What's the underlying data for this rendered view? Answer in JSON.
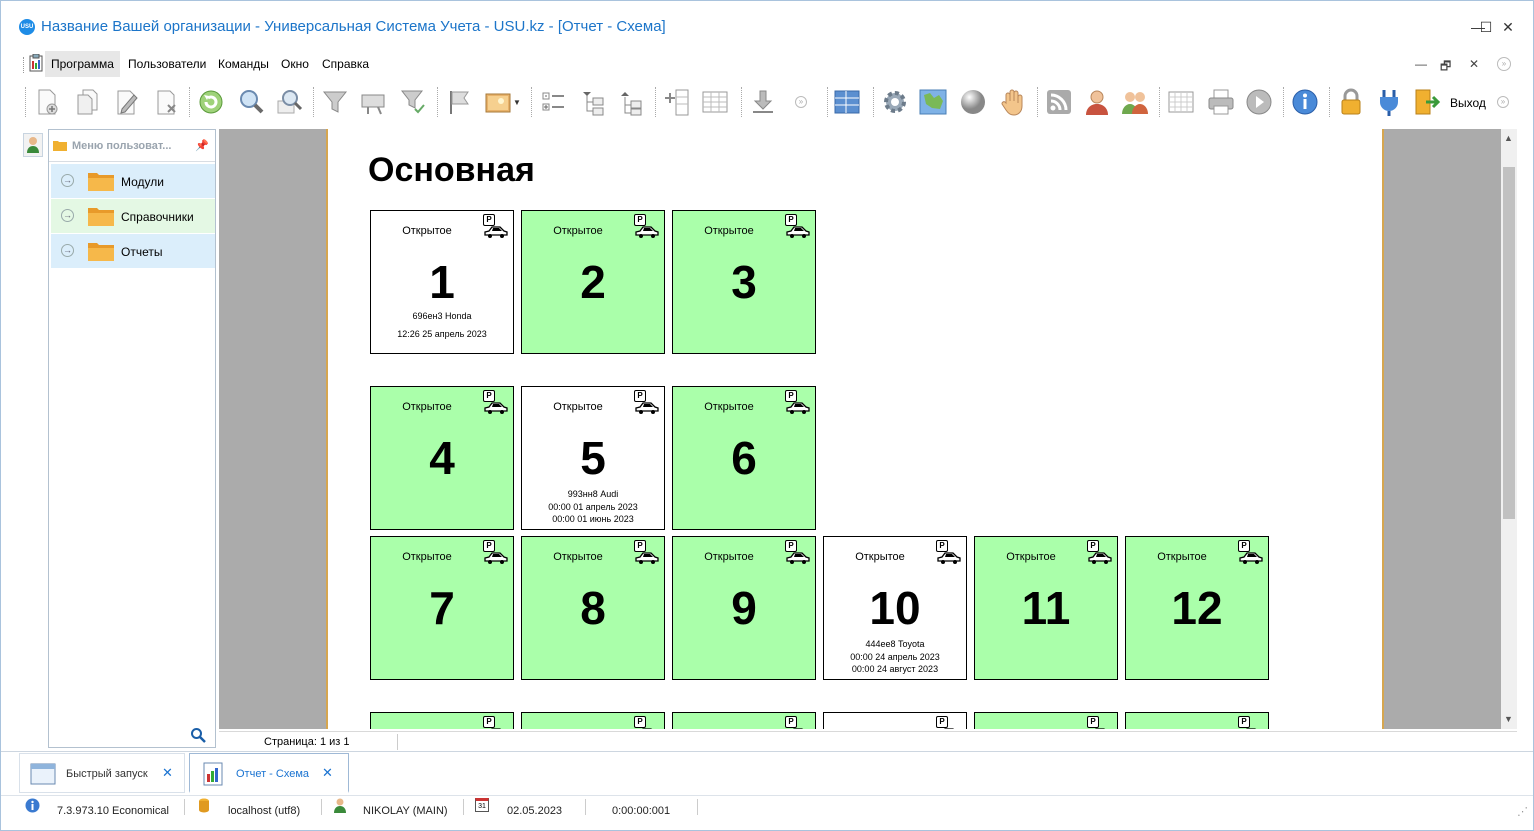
{
  "window": {
    "title": "Название Вашей организации - Универсальная Система Учета - USU.kz - [Отчет - Схема]",
    "logo_text": "USU",
    "controls": {
      "minimize": "—",
      "maximize": "☐",
      "close": "✕"
    }
  },
  "menu": {
    "items": [
      "Программа",
      "Пользователи",
      "Команды",
      "Окно",
      "Справка"
    ],
    "active_index": 0,
    "mdi_controls": {
      "minimize": "—",
      "restore": "🗗",
      "close": "✕"
    }
  },
  "toolbar": {
    "exit_label": "Выход",
    "icons": [
      "add-icon",
      "copy-icon",
      "edit-icon",
      "delete-icon",
      "refresh-icon",
      "search-icon",
      "advanced-search-icon",
      "filter-icon",
      "filter-settings-icon",
      "filter-apply-icon",
      "flag-icon",
      "image-icon",
      "expand-icon",
      "tree-down-icon",
      "tree-up-icon",
      "add-column-icon",
      "grid-icon",
      "download-icon",
      "layout-icon",
      "settings-icon",
      "map-icon",
      "sphere-icon",
      "hand-icon",
      "rss-icon",
      "user-icon",
      "users-icon",
      "table-icon",
      "print-icon",
      "play-icon",
      "info-icon",
      "lock-icon",
      "plug-icon",
      "exit-icon"
    ]
  },
  "nav": {
    "header": "Меню пользоват...",
    "items": [
      {
        "label": "Модули",
        "bg": "#dbeefb"
      },
      {
        "label": "Справочники",
        "bg": "#e4f8e4"
      },
      {
        "label": "Отчеты",
        "bg": "#dbeefb"
      }
    ]
  },
  "report": {
    "title": "Основная",
    "page_info": "Страница: 1 из 1",
    "tiles": [
      {
        "num": "1",
        "status": "Открытое",
        "occupied": true,
        "lines": [
          "696ен3 Honda",
          "12:26 25 апрель 2023"
        ]
      },
      {
        "num": "2",
        "status": "Открытое",
        "occupied": false,
        "lines": []
      },
      {
        "num": "3",
        "status": "Открытое",
        "occupied": false,
        "lines": []
      },
      {
        "num": "4",
        "status": "Открытое",
        "occupied": false,
        "lines": []
      },
      {
        "num": "5",
        "status": "Открытое",
        "occupied": true,
        "lines": [
          "993нн8 Audi",
          "00:00 01 апрель 2023",
          "00:00 01 июнь 2023"
        ]
      },
      {
        "num": "6",
        "status": "Открытое",
        "occupied": false,
        "lines": []
      },
      {
        "num": "7",
        "status": "Открытое",
        "occupied": false,
        "lines": []
      },
      {
        "num": "8",
        "status": "Открытое",
        "occupied": false,
        "lines": []
      },
      {
        "num": "9",
        "status": "Открытое",
        "occupied": false,
        "lines": []
      },
      {
        "num": "10",
        "status": "Открытое",
        "occupied": true,
        "lines": [
          "444ее8 Toyota",
          "00:00 24 апрель 2023",
          "00:00 24 август 2023"
        ]
      },
      {
        "num": "11",
        "status": "Открытое",
        "occupied": false,
        "lines": []
      },
      {
        "num": "12",
        "status": "Открытое",
        "occupied": false,
        "lines": []
      },
      {
        "num": "",
        "status": "",
        "occupied": false,
        "lines": []
      },
      {
        "num": "",
        "status": "",
        "occupied": false,
        "lines": []
      },
      {
        "num": "",
        "status": "",
        "occupied": false,
        "lines": []
      },
      {
        "num": "",
        "status": "",
        "occupied": true,
        "lines": []
      },
      {
        "num": "",
        "status": "",
        "occupied": false,
        "lines": []
      },
      {
        "num": "",
        "status": "",
        "occupied": false,
        "lines": []
      }
    ],
    "free_color": "#aaffaa",
    "occupied_color": "#ffffff"
  },
  "tabs": [
    {
      "label": "Быстрый запуск",
      "active": false
    },
    {
      "label": "Отчет - Схема",
      "active": true
    }
  ],
  "status": {
    "version": "7.3.973.10 Economical",
    "db": "localhost (utf8)",
    "user": "NIKOLAY (MAIN)",
    "date": "02.05.2023",
    "timer": "0:00:00:001",
    "calendar_day": "31"
  }
}
